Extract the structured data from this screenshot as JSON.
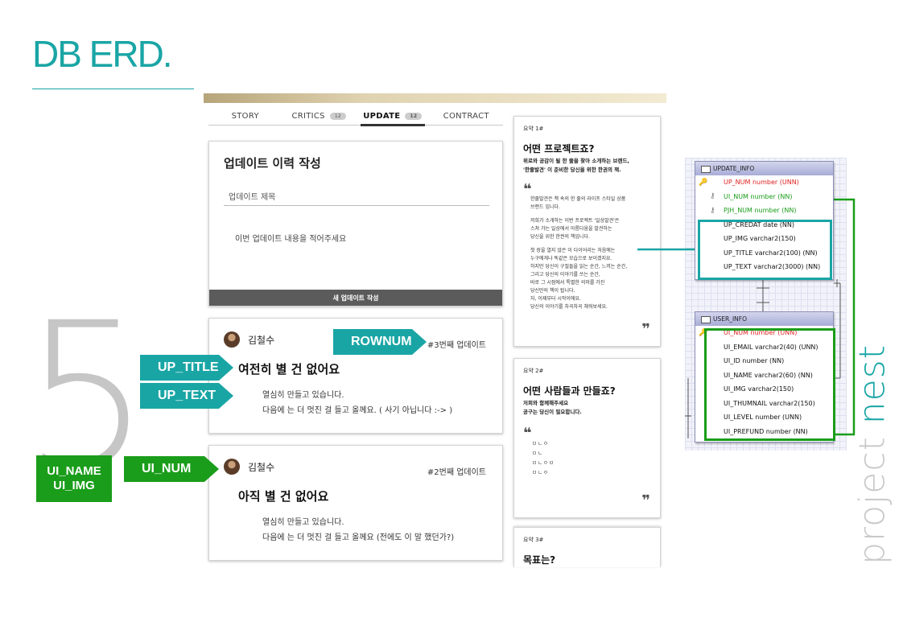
{
  "slide": {
    "title": "DB ERD.",
    "section_number": "5",
    "brand_prefix": "project ",
    "brand_suffix": "nest"
  },
  "tabs": [
    {
      "label": "STORY",
      "badge": ""
    },
    {
      "label": "CRITICS",
      "badge": "12"
    },
    {
      "label": "UPDATE",
      "badge": "12",
      "active": true
    },
    {
      "label": "CONTRACT",
      "badge": ""
    }
  ],
  "write_form": {
    "heading": "업데이트 이력 작성",
    "title_placeholder": "업데이트 제목",
    "body_placeholder": "이번 업데이트 내용을 적어주세요",
    "submit_label": "새 업데이트 작성"
  },
  "updates": [
    {
      "author": "김철수",
      "seq": "#3번째 업데이트",
      "title": "여전히 별 건 없어요",
      "lines": [
        "열심히 만들고 있습니다.",
        "다음에 는 더 멋진 걸 들고 올께요. ( 사기 아닙니다 :-> )"
      ]
    },
    {
      "author": "김철수",
      "seq": "#2번째 업데이트",
      "title": "아직 별 건 없어요",
      "lines": [
        "열심히 만들고 있습니다.",
        "다음에 는 더 멋진 걸 들고 올께요 (전에도 이 말 했던가?)"
      ]
    }
  ],
  "summaries": [
    {
      "label": "요약 1#",
      "question": "어떤 프로젝트죠?",
      "sub": [
        "위로와 공감이 될 한 줄을 찾아 소개하는 브랜드,",
        "'한줄발견' 이 준비한 당신을 위한 한권의 책."
      ],
      "open_quote": "❝",
      "close_quote": "❞",
      "paragraphs": [
        [
          "한줄발견은 책 속의 한 줄의 라이프 스타일 상품",
          "브랜드 입니다."
        ],
        [
          "저희가 소개하는 이번 프로젝트 '일상발견'은",
          "스쳐 가는 일상에서 아름다움을 발견하는",
          "당신을 위한 한권의 책입니다."
        ],
        [
          "첫 장을 열지 않은 이 다이어리는 처음에는",
          "누구에게나 똑같은 모습으로 보이겠지요.",
          "하지만 당신이 구절들을 읽는 순간, 느끼는 순간,",
          "그리고 당신의 이야기를 쓰는 순간,",
          "바로 그 시점에서 특별한 의미를 가진",
          "당신만의 책이 됩니다.",
          "자, 이제부터 시작이에요.",
          "당신의 이야기를 차곡차곡 채워보세요."
        ]
      ]
    },
    {
      "label": "요약 2#",
      "question": "어떤 사람들과 만들죠?",
      "sub": [
        "저희와 함께해주세요",
        "공구는 당신이 필요합니다."
      ],
      "open_quote": "❝",
      "close_quote": "❞",
      "list": [
        "ㅁㄴㅇ",
        "ㅁㄴ",
        "ㅁㄴㅇㅁ",
        "ㅁㄴㅇ"
      ]
    },
    {
      "label": "요약 3#",
      "question": "목표는?"
    }
  ],
  "erd": {
    "update_info": {
      "name": "UPDATE_INFO",
      "columns": [
        {
          "text": "UP_NUM number (UNN)",
          "kind": "pk",
          "key": "gold"
        },
        {
          "text": "UI_NUM number (NN)",
          "kind": "fk",
          "key": "gray"
        },
        {
          "text": "PJH_NUM number (NN)",
          "kind": "fk",
          "key": "gray"
        },
        {
          "text": "UP_CREDAT date (NN)",
          "kind": "col"
        },
        {
          "text": "UP_IMG varchar2(150)",
          "kind": "col"
        },
        {
          "text": "UP_TITLE varchar2(100) (NN)",
          "kind": "col"
        },
        {
          "text": "UP_TEXT varchar2(3000) (NN)",
          "kind": "col"
        }
      ]
    },
    "user_info": {
      "name": "USER_INFO",
      "columns": [
        {
          "text": "UI_NUM number (UNN)",
          "kind": "pk",
          "key": "gold"
        },
        {
          "text": "UI_EMAIL varchar2(40) (UNN)",
          "kind": "col"
        },
        {
          "text": "UI_ID number (NN)",
          "kind": "col"
        },
        {
          "text": "UI_NAME varchar2(60) (NN)",
          "kind": "col"
        },
        {
          "text": "UI_IMG varchar2(150)",
          "kind": "col"
        },
        {
          "text": "UI_THUMNAIL varchar2(150)",
          "kind": "col"
        },
        {
          "text": "UI_LEVEL number (UNN)",
          "kind": "col"
        },
        {
          "text": "UI_PREFUND number (NN)",
          "kind": "col"
        }
      ]
    }
  },
  "callouts": {
    "rownum": "ROWNUM",
    "up_title": "UP_TITLE",
    "up_text": "UP_TEXT",
    "ui_num": "UI_NUM",
    "ui_name": "UI_NAME",
    "ui_img": "UI_IMG"
  },
  "colors": {
    "teal": "#1aa5a5",
    "green": "#1a9d1a",
    "pk_red": "#e02020"
  }
}
